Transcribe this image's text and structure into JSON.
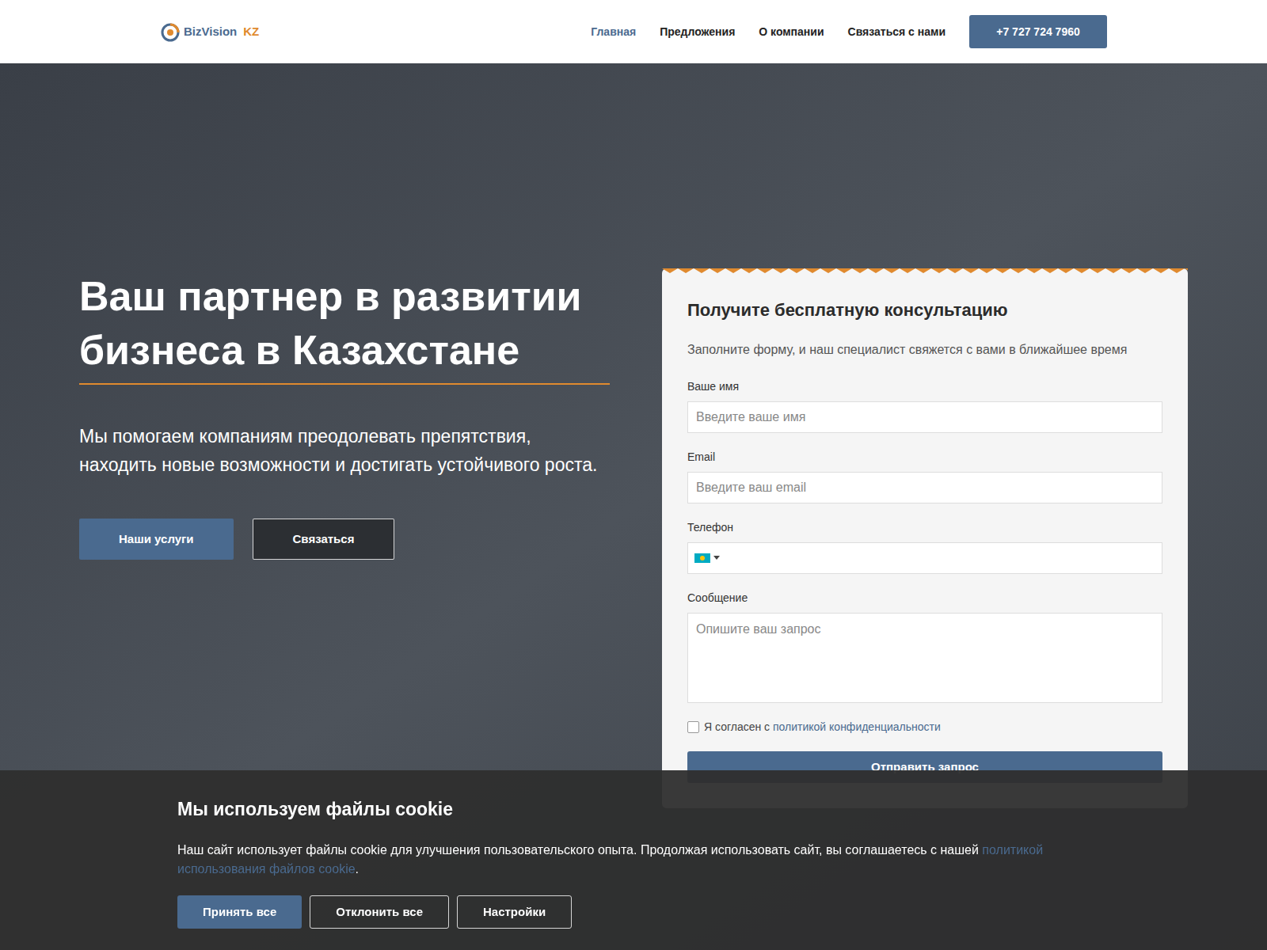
{
  "logo": {
    "name": "BizVision",
    "suffix": "KZ"
  },
  "nav": [
    {
      "label": "Главная",
      "selected": true
    },
    {
      "label": "Предложения",
      "selected": false
    },
    {
      "label": "О компании",
      "selected": false
    },
    {
      "label": "Связаться с нами",
      "selected": false
    }
  ],
  "phone": "+7 727 724 7960",
  "hero": {
    "title": "Ваш партнер в развитии бизнеса в Казахстане",
    "subtitle": "Мы помогаем компаниям преодолевать препятствия, находить новые возможности и достигать устойчивого роста.",
    "buttons": [
      {
        "label": "Наши услуги",
        "kind": "primary"
      },
      {
        "label": "Связаться",
        "kind": "outline"
      }
    ]
  },
  "form": {
    "title": "Получите бесплатную консультацию",
    "subtitle": "Заполните форму, и наш специалист свяжется с вами в ближайшее время",
    "fields": [
      {
        "label": "Ваше имя",
        "placeholder": "Введите ваше имя",
        "kind": "input"
      },
      {
        "label": "Email",
        "placeholder": "Введите ваш email",
        "kind": "input"
      },
      {
        "label": "Телефон",
        "placeholder": "",
        "kind": "phone"
      },
      {
        "label": "Сообщение",
        "placeholder": "Опишите ваш запрос",
        "kind": "textarea"
      }
    ],
    "consent": {
      "text": "Я согласен с ",
      "link": "политикой конфиденциальности",
      "checked": false
    },
    "submit": "Отправить запрос"
  },
  "cookie": {
    "title": "Мы используем файлы cookie",
    "text": "Наш сайт использует файлы cookie для улучшения пользовательского опыта. Продолжая использовать сайт, вы соглашаетесь с нашей ",
    "link": "политикой использования файлов cookie",
    "end": ".",
    "buttons": [
      {
        "label": "Принять все",
        "kind": "primary"
      },
      {
        "label": "Отклонить все",
        "kind": "outline"
      },
      {
        "label": "Настройки",
        "kind": "outline"
      }
    ]
  }
}
